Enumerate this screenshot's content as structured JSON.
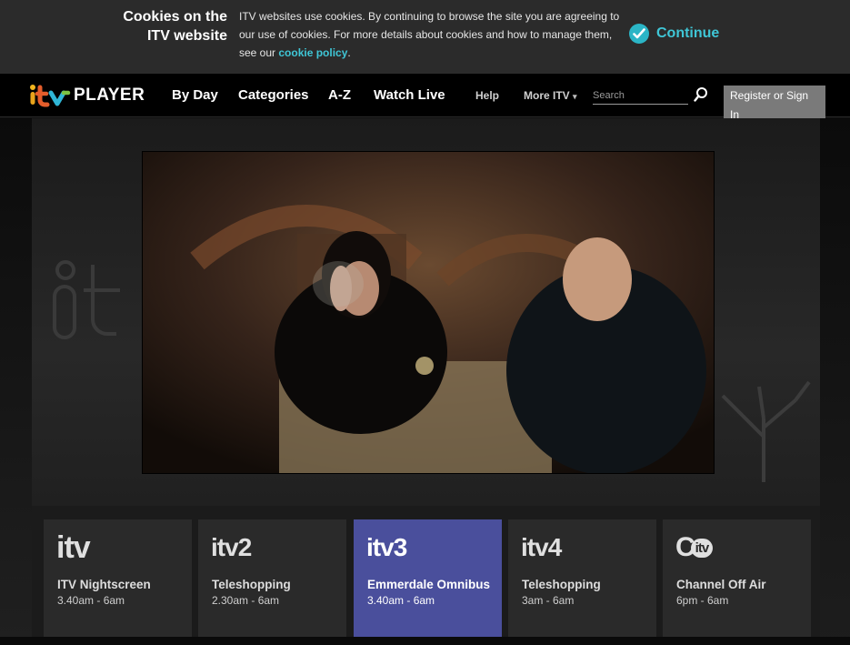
{
  "cookie_bar": {
    "title_line1": "Cookies on the",
    "title_line2": "ITV website",
    "text": "ITV websites use cookies. By continuing to browse the site you are agreeing to our use of cookies. For more details about cookies and how to manage them, see our ",
    "link_text": "cookie policy",
    "after_link": ".",
    "continue_label": "Continue"
  },
  "nav": {
    "logo_text": "PLAYER",
    "links": [
      "By Day",
      "Categories",
      "A-Z",
      "Watch Live"
    ],
    "help": "Help",
    "more": "More ITV",
    "search_placeholder": "Search",
    "register": "Register or Sign In"
  },
  "channels": [
    {
      "logo": "itv",
      "suffix": "",
      "programme": "ITV Nightscreen",
      "time": "3.40am - 6am",
      "active": false
    },
    {
      "logo": "itv",
      "suffix": "2",
      "programme": "Teleshopping",
      "time": "2.30am - 6am",
      "active": false
    },
    {
      "logo": "itv",
      "suffix": "3",
      "programme": "Emmerdale Omnibus",
      "time": "3.40am - 6am",
      "active": true
    },
    {
      "logo": "itv",
      "suffix": "4",
      "programme": "Teleshopping",
      "time": "3am - 6am",
      "active": false
    },
    {
      "logo": "C",
      "suffix": "itv",
      "programme": "Channel Off Air",
      "time": "6pm - 6am",
      "active": false
    }
  ],
  "colors": {
    "accent_teal": "#3fc6d6",
    "active_channel": "#4a4f9c",
    "cookie_bg": "#2b2b2b",
    "register_bg": "#7a7a7a"
  }
}
